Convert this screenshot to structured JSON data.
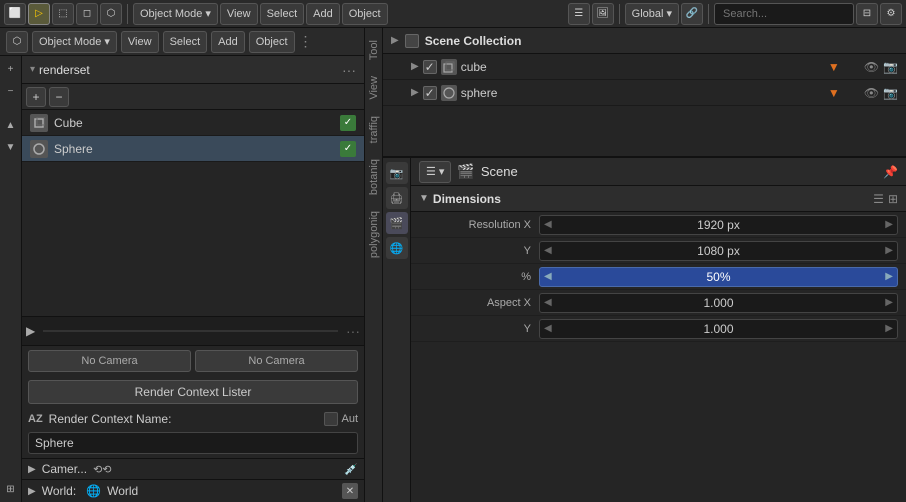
{
  "topbar": {
    "mode_label": "Object Mode",
    "view_label": "View",
    "select_label": "Select",
    "add_label": "Add",
    "object_label": "Object",
    "global_label": "Global",
    "search_placeholder": "Search..."
  },
  "left_panel": {
    "renderset_title": "renderset",
    "objects": [
      {
        "name": "Cube",
        "checked": true
      },
      {
        "name": "Sphere",
        "checked": true
      }
    ],
    "no_camera_1": "No Camera",
    "no_camera_2": "No Camera",
    "render_context_btn": "Render Context Lister",
    "context_name_label": "Render Context Name:",
    "auto_label": "Aut",
    "sphere_value": "Sphere",
    "camera_label": "Camer...",
    "world_label": "World:",
    "world_name": "World"
  },
  "vertical_tabs": [
    {
      "label": "Tool",
      "active": false
    },
    {
      "label": "View",
      "active": false
    },
    {
      "label": "traffiq",
      "active": false
    },
    {
      "label": "botaniq",
      "active": false
    },
    {
      "label": "polygoniq",
      "active": false
    }
  ],
  "outliner": {
    "title": "Scene Collection",
    "items": [
      {
        "name": "cube",
        "has_tri": true
      },
      {
        "name": "sphere",
        "has_tri": true
      }
    ]
  },
  "properties": {
    "scene_label": "Scene",
    "dimensions_title": "Dimensions",
    "fields": [
      {
        "label": "Resolution X",
        "value": "1920 px",
        "highlight": false
      },
      {
        "label": "Y",
        "value": "1080 px",
        "highlight": false
      },
      {
        "label": "%",
        "value": "50%",
        "highlight": true
      },
      {
        "label": "Aspect X",
        "value": "1.000",
        "highlight": false
      },
      {
        "label": "Y",
        "value": "1.000",
        "highlight": false
      }
    ]
  },
  "icons": {
    "expand": "▶",
    "collapse": "▼",
    "plus": "+",
    "minus": "−",
    "eye": "👁",
    "camera": "📷",
    "triangle_right": "▶",
    "triangle_down": "▼",
    "play": "▶",
    "pin": "📌",
    "dots": "···",
    "x": "✕",
    "checktick": "✓",
    "orange_tri": "▼",
    "scene_icon": "🎬",
    "globe": "🌐"
  }
}
